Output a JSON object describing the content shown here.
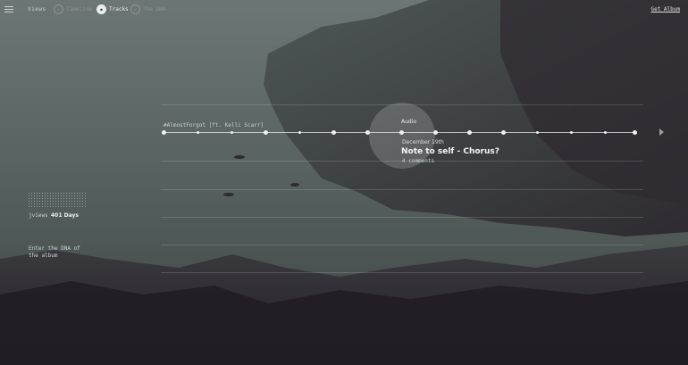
{
  "nav": {
    "views_label": "Views",
    "items": [
      {
        "label": "Timeline",
        "active": false
      },
      {
        "label": "Tracks",
        "active": true
      },
      {
        "label": "The DNA",
        "active": false
      }
    ],
    "get_album_label": "Get Album"
  },
  "timeline": {
    "track_name": "#AlmostForgot [ft. Kelli Scarr]",
    "audio_label": "Audio",
    "date": "December 19th",
    "note_title": "Note to self - Chorus?",
    "comments": "4 comments"
  },
  "stats": {
    "label": "jviews",
    "value": "401 Days",
    "dna_link": "Enter the DNA of the album"
  },
  "icons": {
    "menu": "hamburger-icon",
    "next": "play-arrow-icon"
  },
  "colors": {
    "text": "#d7dcdb",
    "accent": "#eef1f0",
    "sea": "#4f5b5b",
    "land": "#2f2c33"
  }
}
